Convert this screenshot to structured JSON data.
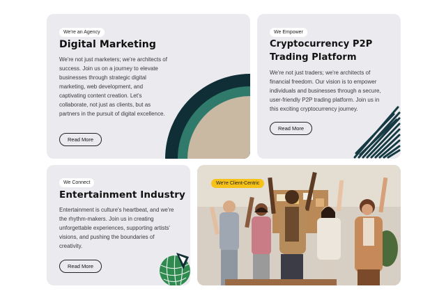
{
  "cards": [
    {
      "badge": "We're an Agency",
      "title": "Digital Marketing",
      "description": "We're not just marketers; we're architects of success. Join us on a journey to elevate businesses through strategic digital marketing, web development, and captivating content creation. Let's collaborate, not just as clients, but as partners in the pursuit of digital excellence.",
      "button": "Read More"
    },
    {
      "badge": "We Empower",
      "title_line1": "Cryptocurrency P2P",
      "title_line2": "Trading Platform",
      "description": "We're not just traders; we're architects of financial freedom. Our vision is to empower individuals and businesses through a secure, user-friendly P2P trading platform. Join us in this exciting cryptocurrency journey.",
      "button": "Read More"
    },
    {
      "badge": "We Connect",
      "title": "Entertainment Industry",
      "description": "Entertainment is culture's heartbeat, and we're the rhythm-makers. Join us in creating unforgettable experiences, supporting artists' visions, and pushing the boundaries of creativity.",
      "button": "Read More"
    },
    {
      "badge": "We're Client-Centric"
    }
  ],
  "colors": {
    "card_bg": "#ebebef",
    "arc_dark": "#0f2e36",
    "arc_green": "#2f7a6a",
    "arc_beige": "#c9b9a3",
    "badge_yellow": "#f6c21a"
  },
  "icons": {
    "arc_graphic": "concentric-arcs-graphic",
    "scribble_graphic": "scribble-graphic",
    "globe_graphic": "green-globe-graphic",
    "photo": "team-celebration-photo"
  }
}
